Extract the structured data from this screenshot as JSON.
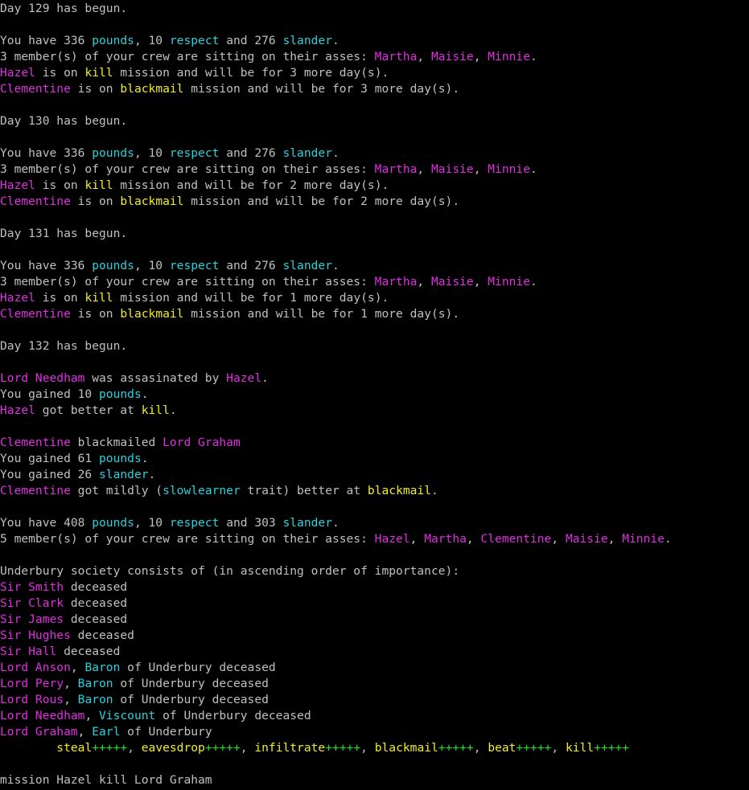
{
  "colors": {
    "background": "#000000",
    "default_text": "#c0c0c0",
    "currency_stats": "#28d2dc",
    "names": "#e02ee0",
    "missions_skills": "#f2ee22",
    "skill_pluses": "#20e020"
  },
  "lines": [
    [
      {
        "t": "Day 129 has begun.",
        "c": "w"
      }
    ],
    [],
    [
      {
        "t": "You have 336 ",
        "c": "w"
      },
      {
        "t": "pounds",
        "c": "c"
      },
      {
        "t": ", 10 ",
        "c": "w"
      },
      {
        "t": "respect",
        "c": "c"
      },
      {
        "t": " and 276 ",
        "c": "w"
      },
      {
        "t": "slander",
        "c": "c"
      },
      {
        "t": ".",
        "c": "w"
      }
    ],
    [
      {
        "t": "3 member(s) of your crew are sitting on their asses: ",
        "c": "w"
      },
      {
        "t": "Martha",
        "c": "m"
      },
      {
        "t": ", ",
        "c": "w"
      },
      {
        "t": "Maisie",
        "c": "m"
      },
      {
        "t": ", ",
        "c": "w"
      },
      {
        "t": "Minnie",
        "c": "m"
      },
      {
        "t": ".",
        "c": "w"
      }
    ],
    [
      {
        "t": "Hazel",
        "c": "m"
      },
      {
        "t": " is on ",
        "c": "w"
      },
      {
        "t": "kill",
        "c": "y"
      },
      {
        "t": " mission and will be for 3 more day(s).",
        "c": "w"
      }
    ],
    [
      {
        "t": "Clementine",
        "c": "m"
      },
      {
        "t": " is on ",
        "c": "w"
      },
      {
        "t": "blackmail",
        "c": "y"
      },
      {
        "t": " mission and will be for 3 more day(s).",
        "c": "w"
      }
    ],
    [],
    [
      {
        "t": "Day 130 has begun.",
        "c": "w"
      }
    ],
    [],
    [
      {
        "t": "You have 336 ",
        "c": "w"
      },
      {
        "t": "pounds",
        "c": "c"
      },
      {
        "t": ", 10 ",
        "c": "w"
      },
      {
        "t": "respect",
        "c": "c"
      },
      {
        "t": " and 276 ",
        "c": "w"
      },
      {
        "t": "slander",
        "c": "c"
      },
      {
        "t": ".",
        "c": "w"
      }
    ],
    [
      {
        "t": "3 member(s) of your crew are sitting on their asses: ",
        "c": "w"
      },
      {
        "t": "Martha",
        "c": "m"
      },
      {
        "t": ", ",
        "c": "w"
      },
      {
        "t": "Maisie",
        "c": "m"
      },
      {
        "t": ", ",
        "c": "w"
      },
      {
        "t": "Minnie",
        "c": "m"
      },
      {
        "t": ".",
        "c": "w"
      }
    ],
    [
      {
        "t": "Hazel",
        "c": "m"
      },
      {
        "t": " is on ",
        "c": "w"
      },
      {
        "t": "kill",
        "c": "y"
      },
      {
        "t": " mission and will be for 2 more day(s).",
        "c": "w"
      }
    ],
    [
      {
        "t": "Clementine",
        "c": "m"
      },
      {
        "t": " is on ",
        "c": "w"
      },
      {
        "t": "blackmail",
        "c": "y"
      },
      {
        "t": " mission and will be for 2 more day(s).",
        "c": "w"
      }
    ],
    [],
    [
      {
        "t": "Day 131 has begun.",
        "c": "w"
      }
    ],
    [],
    [
      {
        "t": "You have 336 ",
        "c": "w"
      },
      {
        "t": "pounds",
        "c": "c"
      },
      {
        "t": ", 10 ",
        "c": "w"
      },
      {
        "t": "respect",
        "c": "c"
      },
      {
        "t": " and 276 ",
        "c": "w"
      },
      {
        "t": "slander",
        "c": "c"
      },
      {
        "t": ".",
        "c": "w"
      }
    ],
    [
      {
        "t": "3 member(s) of your crew are sitting on their asses: ",
        "c": "w"
      },
      {
        "t": "Martha",
        "c": "m"
      },
      {
        "t": ", ",
        "c": "w"
      },
      {
        "t": "Maisie",
        "c": "m"
      },
      {
        "t": ", ",
        "c": "w"
      },
      {
        "t": "Minnie",
        "c": "m"
      },
      {
        "t": ".",
        "c": "w"
      }
    ],
    [
      {
        "t": "Hazel",
        "c": "m"
      },
      {
        "t": " is on ",
        "c": "w"
      },
      {
        "t": "kill",
        "c": "y"
      },
      {
        "t": " mission and will be for 1 more day(s).",
        "c": "w"
      }
    ],
    [
      {
        "t": "Clementine",
        "c": "m"
      },
      {
        "t": " is on ",
        "c": "w"
      },
      {
        "t": "blackmail",
        "c": "y"
      },
      {
        "t": " mission and will be for 1 more day(s).",
        "c": "w"
      }
    ],
    [],
    [
      {
        "t": "Day 132 has begun.",
        "c": "w"
      }
    ],
    [],
    [
      {
        "t": "Lord Needham",
        "c": "m"
      },
      {
        "t": " was assasinated by ",
        "c": "w"
      },
      {
        "t": "Hazel",
        "c": "m"
      },
      {
        "t": ".",
        "c": "w"
      }
    ],
    [
      {
        "t": "You gained 10 ",
        "c": "w"
      },
      {
        "t": "pounds",
        "c": "c"
      },
      {
        "t": ".",
        "c": "w"
      }
    ],
    [
      {
        "t": "Hazel",
        "c": "m"
      },
      {
        "t": " got better at ",
        "c": "w"
      },
      {
        "t": "kill",
        "c": "y"
      },
      {
        "t": ".",
        "c": "w"
      }
    ],
    [],
    [
      {
        "t": "Clementine",
        "c": "m"
      },
      {
        "t": " blackmailed ",
        "c": "w"
      },
      {
        "t": "Lord Graham",
        "c": "m"
      }
    ],
    [
      {
        "t": "You gained 61 ",
        "c": "w"
      },
      {
        "t": "pounds",
        "c": "c"
      },
      {
        "t": ".",
        "c": "w"
      }
    ],
    [
      {
        "t": "You gained 26 ",
        "c": "w"
      },
      {
        "t": "slander",
        "c": "c"
      },
      {
        "t": ".",
        "c": "w"
      }
    ],
    [
      {
        "t": "Clementine",
        "c": "m"
      },
      {
        "t": " got mildly (",
        "c": "w"
      },
      {
        "t": "slowlearner",
        "c": "c"
      },
      {
        "t": " trait) better at ",
        "c": "w"
      },
      {
        "t": "blackmail",
        "c": "y"
      },
      {
        "t": ".",
        "c": "w"
      }
    ],
    [],
    [
      {
        "t": "You have 408 ",
        "c": "w"
      },
      {
        "t": "pounds",
        "c": "c"
      },
      {
        "t": ", 10 ",
        "c": "w"
      },
      {
        "t": "respect",
        "c": "c"
      },
      {
        "t": " and 303 ",
        "c": "w"
      },
      {
        "t": "slander",
        "c": "c"
      },
      {
        "t": ".",
        "c": "w"
      }
    ],
    [
      {
        "t": "5 member(s) of your crew are sitting on their asses: ",
        "c": "w"
      },
      {
        "t": "Hazel",
        "c": "m"
      },
      {
        "t": ", ",
        "c": "w"
      },
      {
        "t": "Martha",
        "c": "m"
      },
      {
        "t": ", ",
        "c": "w"
      },
      {
        "t": "Clementine",
        "c": "m"
      },
      {
        "t": ", ",
        "c": "w"
      },
      {
        "t": "Maisie",
        "c": "m"
      },
      {
        "t": ", ",
        "c": "w"
      },
      {
        "t": "Minnie",
        "c": "m"
      },
      {
        "t": ".",
        "c": "w"
      }
    ],
    [],
    [
      {
        "t": "Underbury society consists of (in ascending order of importance):",
        "c": "w"
      }
    ],
    [
      {
        "t": "Sir Smith",
        "c": "m"
      },
      {
        "t": " deceased",
        "c": "w"
      }
    ],
    [
      {
        "t": "Sir Clark",
        "c": "m"
      },
      {
        "t": " deceased",
        "c": "w"
      }
    ],
    [
      {
        "t": "Sir James",
        "c": "m"
      },
      {
        "t": " deceased",
        "c": "w"
      }
    ],
    [
      {
        "t": "Sir Hughes",
        "c": "m"
      },
      {
        "t": " deceased",
        "c": "w"
      }
    ],
    [
      {
        "t": "Sir Hall",
        "c": "m"
      },
      {
        "t": " deceased",
        "c": "w"
      }
    ],
    [
      {
        "t": "Lord Anson",
        "c": "m"
      },
      {
        "t": ", ",
        "c": "w"
      },
      {
        "t": "Baron",
        "c": "c"
      },
      {
        "t": " of Underbury deceased",
        "c": "w"
      }
    ],
    [
      {
        "t": "Lord Pery",
        "c": "m"
      },
      {
        "t": ", ",
        "c": "w"
      },
      {
        "t": "Baron",
        "c": "c"
      },
      {
        "t": " of Underbury deceased",
        "c": "w"
      }
    ],
    [
      {
        "t": "Lord Rous",
        "c": "m"
      },
      {
        "t": ", ",
        "c": "w"
      },
      {
        "t": "Baron",
        "c": "c"
      },
      {
        "t": " of Underbury deceased",
        "c": "w"
      }
    ],
    [
      {
        "t": "Lord Needham",
        "c": "m"
      },
      {
        "t": ", ",
        "c": "w"
      },
      {
        "t": "Viscount",
        "c": "c"
      },
      {
        "t": " of Underbury deceased",
        "c": "w"
      }
    ],
    [
      {
        "t": "Lord Graham",
        "c": "m"
      },
      {
        "t": ", ",
        "c": "w"
      },
      {
        "t": "Earl",
        "c": "c"
      },
      {
        "t": " of Underbury",
        "c": "w"
      }
    ],
    [
      {
        "t": "        ",
        "c": "w"
      },
      {
        "t": "steal",
        "c": "gy"
      },
      {
        "t": "+++++",
        "c": "g"
      },
      {
        "t": ", ",
        "c": "w"
      },
      {
        "t": "eavesdrop",
        "c": "gy"
      },
      {
        "t": "+++++",
        "c": "g"
      },
      {
        "t": ", ",
        "c": "w"
      },
      {
        "t": "infiltrate",
        "c": "gy"
      },
      {
        "t": "+++++",
        "c": "g"
      },
      {
        "t": ", ",
        "c": "w"
      },
      {
        "t": "blackmail",
        "c": "gy"
      },
      {
        "t": "+++++",
        "c": "g"
      },
      {
        "t": ", ",
        "c": "w"
      },
      {
        "t": "beat",
        "c": "gy"
      },
      {
        "t": "+++++",
        "c": "g"
      },
      {
        "t": ", ",
        "c": "w"
      },
      {
        "t": "kill",
        "c": "gy"
      },
      {
        "t": "+++++",
        "c": "g"
      }
    ],
    [],
    [
      {
        "t": "mission Hazel kill Lord Graham",
        "c": "w"
      }
    ]
  ]
}
